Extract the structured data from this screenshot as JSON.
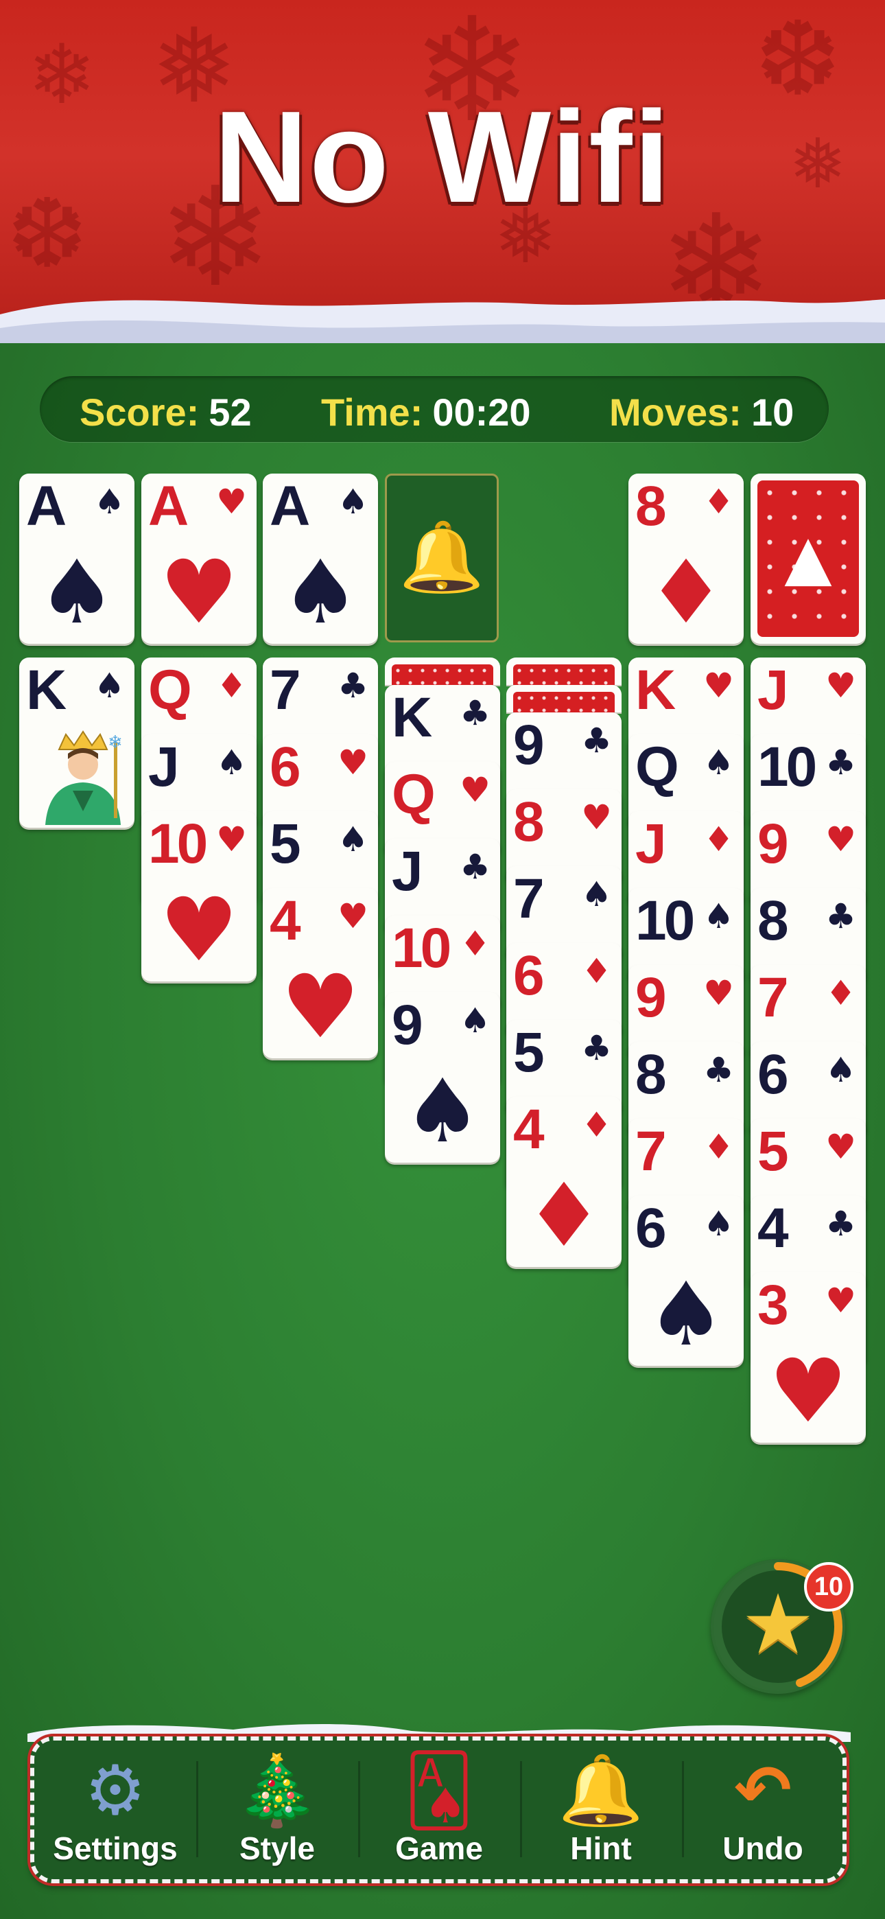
{
  "banner": {
    "title": "No Wifi"
  },
  "stats": {
    "score_label": "Score:",
    "score_value": "52",
    "time_label": "Time:",
    "time_value": "00:20",
    "moves_label": "Moves:",
    "moves_value": "10"
  },
  "colors": {
    "felt": "#2b7a2f",
    "banner_red": "#c9261e",
    "card_red": "#d3202a",
    "card_black": "#17193a",
    "stat_label": "#f3e04a"
  },
  "foundations": [
    {
      "rank": "A",
      "suit": "♠",
      "color": "blk"
    },
    {
      "rank": "A",
      "suit": "♥",
      "color": "red"
    },
    {
      "rank": "A",
      "suit": "♠",
      "color": "blk"
    },
    {
      "empty": true,
      "icon": "bell-icon"
    }
  ],
  "waste": {
    "rank": "8",
    "suit": "♦",
    "color": "red"
  },
  "stock": {
    "icon": "christmas-tree-icon"
  },
  "tableau": [
    {
      "facedown": 0,
      "cards": [
        {
          "rank": "K",
          "suit": "♠",
          "color": "blk",
          "face": "king-art"
        }
      ]
    },
    {
      "facedown": 0,
      "cards": [
        {
          "rank": "Q",
          "suit": "♦",
          "color": "red"
        },
        {
          "rank": "J",
          "suit": "♠",
          "color": "blk"
        },
        {
          "rank": "10",
          "suit": "♥",
          "color": "red"
        }
      ]
    },
    {
      "facedown": 0,
      "cards": [
        {
          "rank": "7",
          "suit": "♣",
          "color": "blk"
        },
        {
          "rank": "6",
          "suit": "♥",
          "color": "red"
        },
        {
          "rank": "5",
          "suit": "♠",
          "color": "blk"
        },
        {
          "rank": "4",
          "suit": "♥",
          "color": "red"
        }
      ]
    },
    {
      "facedown": 1,
      "cards": [
        {
          "rank": "K",
          "suit": "♣",
          "color": "blk"
        },
        {
          "rank": "Q",
          "suit": "♥",
          "color": "red"
        },
        {
          "rank": "J",
          "suit": "♣",
          "color": "blk"
        },
        {
          "rank": "10",
          "suit": "♦",
          "color": "red"
        },
        {
          "rank": "9",
          "suit": "♠",
          "color": "blk"
        }
      ]
    },
    {
      "facedown": 2,
      "cards": [
        {
          "rank": "9",
          "suit": "♣",
          "color": "blk"
        },
        {
          "rank": "8",
          "suit": "♥",
          "color": "red"
        },
        {
          "rank": "7",
          "suit": "♠",
          "color": "blk"
        },
        {
          "rank": "6",
          "suit": "♦",
          "color": "red"
        },
        {
          "rank": "5",
          "suit": "♣",
          "color": "blk"
        },
        {
          "rank": "4",
          "suit": "♦",
          "color": "red"
        }
      ]
    },
    {
      "facedown": 0,
      "cards": [
        {
          "rank": "K",
          "suit": "♥",
          "color": "red"
        },
        {
          "rank": "Q",
          "suit": "♠",
          "color": "blk"
        },
        {
          "rank": "J",
          "suit": "♦",
          "color": "red"
        },
        {
          "rank": "10",
          "suit": "♠",
          "color": "blk"
        },
        {
          "rank": "9",
          "suit": "♥",
          "color": "red"
        },
        {
          "rank": "8",
          "suit": "♣",
          "color": "blk"
        },
        {
          "rank": "7",
          "suit": "♦",
          "color": "red"
        },
        {
          "rank": "6",
          "suit": "♠",
          "color": "blk"
        }
      ]
    },
    {
      "facedown": 0,
      "cards": [
        {
          "rank": "J",
          "suit": "♥",
          "color": "red"
        },
        {
          "rank": "10",
          "suit": "♣",
          "color": "blk"
        },
        {
          "rank": "9",
          "suit": "♥",
          "color": "red"
        },
        {
          "rank": "8",
          "suit": "♣",
          "color": "blk"
        },
        {
          "rank": "7",
          "suit": "♦",
          "color": "red"
        },
        {
          "rank": "6",
          "suit": "♠",
          "color": "blk"
        },
        {
          "rank": "5",
          "suit": "♥",
          "color": "red"
        },
        {
          "rank": "4",
          "suit": "♣",
          "color": "blk"
        },
        {
          "rank": "3",
          "suit": "♥",
          "color": "red"
        }
      ]
    }
  ],
  "wand": {
    "badge": "10",
    "icon": "magic-wand-icon"
  },
  "toolbar": {
    "items": [
      {
        "label": "Settings",
        "icon": "gear-icon"
      },
      {
        "label": "Style",
        "icon": "christmas-tree-icon"
      },
      {
        "label": "Game",
        "icon": "cards-icon"
      },
      {
        "label": "Hint",
        "icon": "bell-icon"
      },
      {
        "label": "Undo",
        "icon": "undo-arrow-icon"
      }
    ]
  }
}
